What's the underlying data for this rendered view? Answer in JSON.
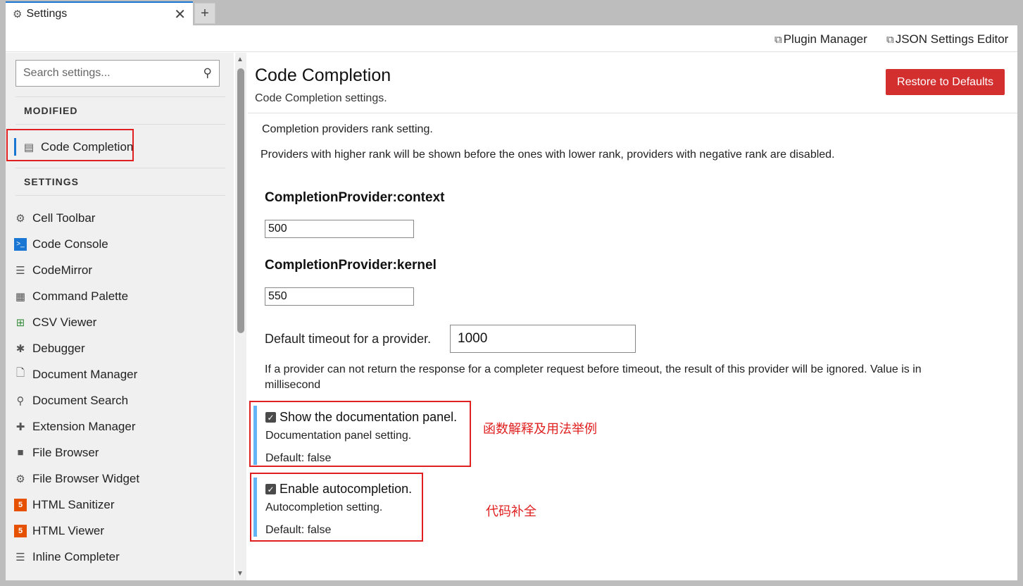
{
  "tab": {
    "icon": "gear-icon",
    "title": "Settings",
    "close": "✕",
    "add": "+"
  },
  "toolbar": {
    "plugin_manager": "Plugin Manager",
    "json_editor": "JSON Settings Editor"
  },
  "sidebar": {
    "search_placeholder": "Search settings...",
    "modified_heading": "MODIFIED",
    "modified_items": [
      {
        "label": "Code Completion",
        "icon": "list-icon",
        "active": true
      }
    ],
    "settings_heading": "SETTINGS",
    "items": [
      {
        "label": "Cell Toolbar",
        "icon": "gear-icon"
      },
      {
        "label": "Code Console",
        "icon": "console-icon"
      },
      {
        "label": "CodeMirror",
        "icon": "lines-icon"
      },
      {
        "label": "Command Palette",
        "icon": "palette-icon"
      },
      {
        "label": "CSV Viewer",
        "icon": "grid-icon"
      },
      {
        "label": "Debugger",
        "icon": "bug-icon"
      },
      {
        "label": "Document Manager",
        "icon": "file-icon"
      },
      {
        "label": "Document Search",
        "icon": "search-icon"
      },
      {
        "label": "Extension Manager",
        "icon": "puzzle-icon"
      },
      {
        "label": "File Browser",
        "icon": "folder-icon"
      },
      {
        "label": "File Browser Widget",
        "icon": "gear-icon"
      },
      {
        "label": "HTML Sanitizer",
        "icon": "html5-icon"
      },
      {
        "label": "HTML Viewer",
        "icon": "html5-icon"
      },
      {
        "label": "Inline Completer",
        "icon": "lines-icon"
      }
    ]
  },
  "content": {
    "title": "Code Completion",
    "subtitle": "Code Completion settings.",
    "restore_button": "Restore to Defaults",
    "rank_heading": "Completion providers rank setting.",
    "rank_desc": "Providers with higher rank will be shown before the ones with lower rank, providers with negative rank are disabled.",
    "providers": [
      {
        "label": "CompletionProvider:context",
        "value": "500"
      },
      {
        "label": "CompletionProvider:kernel",
        "value": "550"
      }
    ],
    "timeout_label": "Default timeout for a provider.",
    "timeout_value": "1000",
    "timeout_desc_1": "If a provider can not return the response for a completer request before timeout, the result of this provider will be ignored. Value is in",
    "timeout_desc_2": "millisecond",
    "show_doc": {
      "label": "Show the documentation panel.",
      "desc": "Documentation panel setting.",
      "default": "Default: false",
      "checked": true
    },
    "autocompletion": {
      "label": "Enable autocompletion.",
      "desc": "Autocompletion setting.",
      "default": "Default: false",
      "checked": true
    }
  },
  "annotations": {
    "doc_note": "函数解释及用法举例",
    "auto_note": "代码补全"
  },
  "colors": {
    "accent": "#1976d2",
    "restore": "#d32f2f",
    "annotation": "#e02020",
    "bool_bar": "#64b5f6"
  }
}
